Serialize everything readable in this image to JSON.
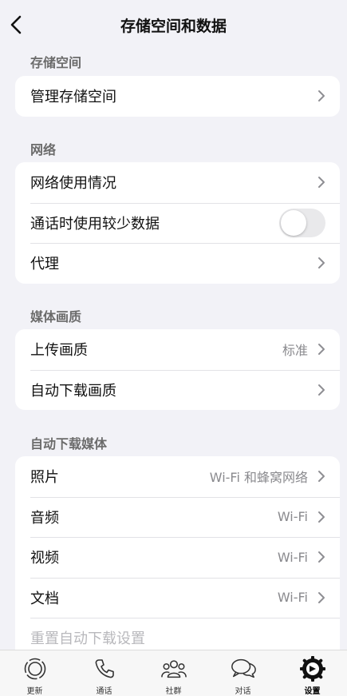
{
  "header": {
    "title": "存储空间和数据"
  },
  "sections": {
    "storage": {
      "title": "存储空间",
      "manage": "管理存储空间"
    },
    "network": {
      "title": "网络",
      "usage": "网络使用情况",
      "low_data": "通话时使用较少数据",
      "low_data_on": false,
      "proxy": "代理"
    },
    "media_quality": {
      "title": "媒体画质",
      "upload": "上传画质",
      "upload_value": "标准",
      "auto_download": "自动下载画质"
    },
    "auto_download_media": {
      "title": "自动下载媒体",
      "photos": "照片",
      "photos_value": "Wi-Fi 和蜂窝网络",
      "audio": "音频",
      "audio_value": "Wi-Fi",
      "video": "视频",
      "video_value": "Wi-Fi",
      "documents": "文档",
      "documents_value": "Wi-Fi",
      "reset": "重置自动下载设置"
    }
  },
  "tabbar": {
    "updates": "更新",
    "calls": "通话",
    "communities": "社群",
    "chats": "对话",
    "settings": "设置"
  },
  "icons": [
    "back-icon",
    "chevron-right-icon",
    "updates-icon",
    "phone-icon",
    "communities-icon",
    "chats-icon",
    "settings-icon"
  ]
}
